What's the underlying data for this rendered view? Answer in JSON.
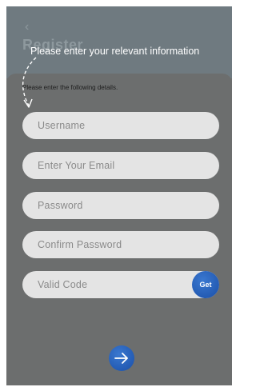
{
  "header": {
    "back_icon": "chevron-left-icon",
    "title": "Register"
  },
  "hint": {
    "text": "Please enter your relevant information"
  },
  "form": {
    "subtitle": "Please enter the following details.",
    "username_placeholder": "Username",
    "email_placeholder": "Enter Your Email",
    "password_placeholder": "Password",
    "confirm_password_placeholder": "Confirm  Password",
    "valid_code_placeholder": "Valid  Code",
    "get_button_label": "Get",
    "next_button_icon": "arrow-right-icon"
  },
  "colors": {
    "accent": "#1f5db8",
    "overlay": "#6e7070",
    "field_bg": "#e4e4e4"
  }
}
